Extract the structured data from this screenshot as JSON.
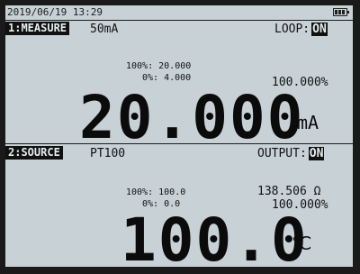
{
  "header": {
    "datetime": "2019/06/19 13:29",
    "battery_icon": "battery-full-icon"
  },
  "measure": {
    "label": "1:MEASURE",
    "range": "50mA",
    "loop_label": "LOOP:",
    "loop_state": "ON",
    "scale_100_label": "100%:",
    "scale_100_value": "20.000",
    "scale_0_label": "0%:",
    "scale_0_value": "4.000",
    "percent": "100.000%",
    "value": "20.000",
    "unit": "mA"
  },
  "source": {
    "label": "2:SOURCE",
    "type": "PT100",
    "output_label": "OUTPUT:",
    "output_state": "ON",
    "scale_100_label": "100%:",
    "scale_100_value": "100.0",
    "scale_0_label": "0%:",
    "scale_0_value": "0.0",
    "resistance": "138.506 Ω",
    "percent": "100.000%",
    "value": "100.0",
    "unit": "℃"
  }
}
